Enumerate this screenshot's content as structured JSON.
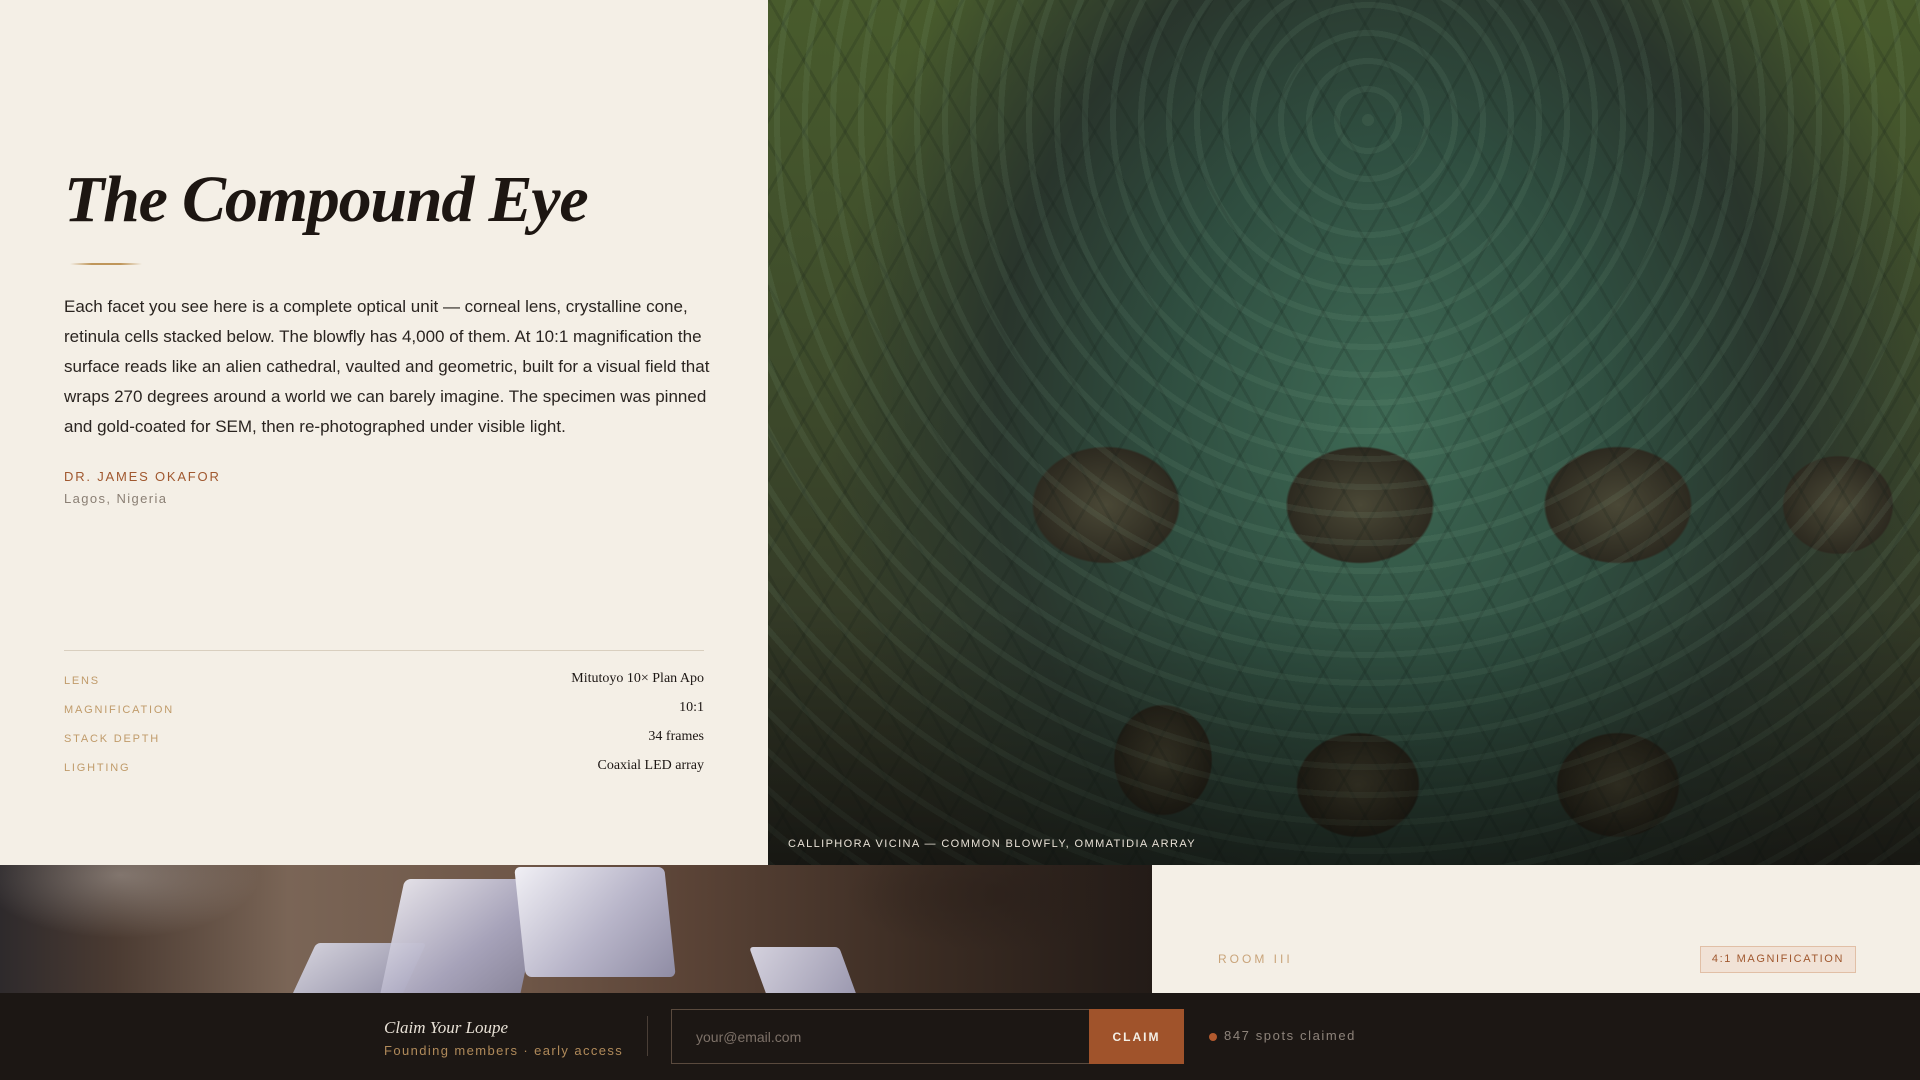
{
  "article": {
    "title": "The Compound Eye",
    "body": "Each facet you see here is a complete optical unit — corneal lens, crystalline cone, retinula cells stacked below. The blowfly has 4,000 of them. At 10:1 magnification the surface reads like an alien cathedral, vaulted and geometric, built for a visual field that wraps 270 degrees around a world we can barely imagine. The specimen was pinned and gold-coated for SEM, then re-photographed under visible light.",
    "author": "DR. JAMES OKAFOR",
    "location": "Lagos, Nigeria"
  },
  "specs": [
    {
      "label": "LENS",
      "value": "Mitutoyo 10× Plan Apo"
    },
    {
      "label": "MAGNIFICATION",
      "value": "10:1"
    },
    {
      "label": "STACK DEPTH",
      "value": "34 frames"
    },
    {
      "label": "LIGHTING",
      "value": "Coaxial LED array"
    }
  ],
  "hero": {
    "caption": "CALLIPHORA VICINA — COMMON BLOWFLY, OMMATIDIA ARRAY"
  },
  "room_card": {
    "room": "ROOM III",
    "badge": "4:1 MAGNIFICATION"
  },
  "signup": {
    "title": "Claim Your Loupe",
    "subtitle": "Founding members · early access",
    "email_placeholder": "your@email.com",
    "button_label": "CLAIM",
    "status": "847 spots claimed"
  },
  "colors": {
    "accent": "#a0532b",
    "background": "#f4efe6",
    "dark_bar": "#1c1714",
    "gold": "#c09b6a"
  }
}
